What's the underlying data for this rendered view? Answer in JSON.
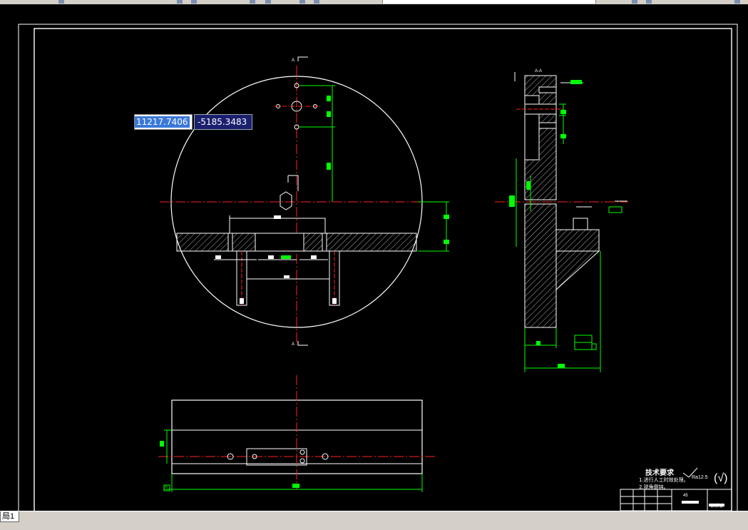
{
  "coords": {
    "x": "11217.7406",
    "y": "-5185.3483"
  },
  "layout_tab": "局1",
  "tech": {
    "title": "技术要求",
    "notes": [
      "1.进行人工时效处理。",
      "2.锐角倒钝。"
    ],
    "roughness": "Ra12.5",
    "check_mark": "(√)"
  },
  "title_block": {
    "material": "45",
    "name": "钻模板"
  },
  "labels": {
    "section_a_top": "A",
    "section_a_bottom": "A",
    "datum_a": "A",
    "section_view": "A-A"
  },
  "colors": {
    "dimension": "#00ff00",
    "center": "#ff2020",
    "geometry": "#ffffff",
    "background": "#000000"
  }
}
